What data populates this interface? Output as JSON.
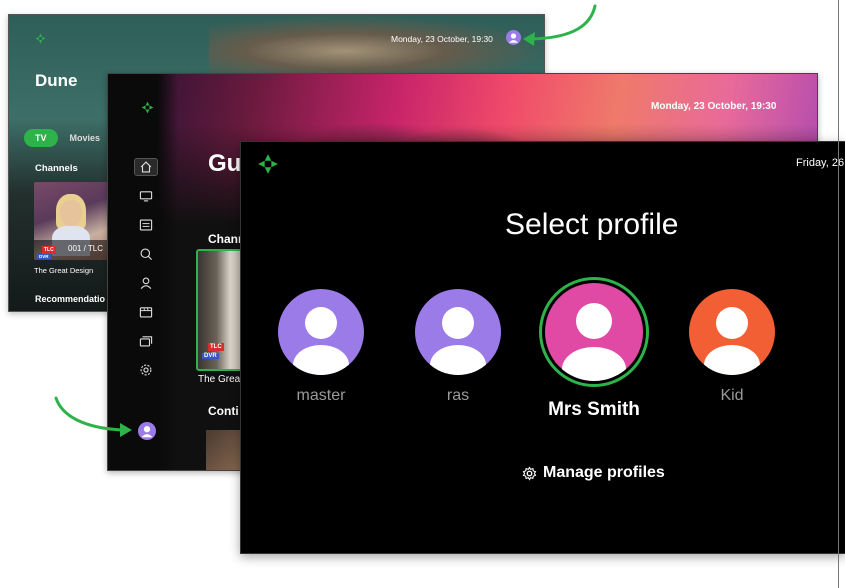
{
  "colors": {
    "accent_green": "#2db34a",
    "avatar_purple": "#9b7be8",
    "avatar_pink": "#e04aa5",
    "avatar_orange": "#f25f35"
  },
  "back_screen": {
    "datetime": "Monday, 23 October, 19:30",
    "hero_title": "Dune",
    "tabs": [
      {
        "label": "TV",
        "active": true
      },
      {
        "label": "Movies",
        "active": false
      }
    ],
    "section_channels": "Channels",
    "channel_card": {
      "badge": "TLC",
      "dvr": "DVR",
      "number_text": "001  /  TLC",
      "title": "The Great Design"
    },
    "section_recommendations": "Recommendatio"
  },
  "middle_screen": {
    "datetime": "Monday, 23 October, 19:30",
    "hero_title": "Gu",
    "section_channels": "Chann",
    "channel_card": {
      "badge": "TLC",
      "dvr": "DVR",
      "title": "The Great"
    },
    "section_continue": "Conti",
    "nav_icons": [
      "home-icon",
      "tv-icon",
      "guide-icon",
      "search-icon",
      "user-icon",
      "movies-icon",
      "recordings-icon",
      "settings-icon"
    ]
  },
  "front_screen": {
    "datetime": "Friday, 26",
    "heading": "Select profile",
    "profiles": [
      {
        "name": "master",
        "color": "#9b7be8",
        "selected": false
      },
      {
        "name": "ras",
        "color": "#9b7be8",
        "selected": false
      },
      {
        "name": "Mrs Smith",
        "color": "#e04aa5",
        "selected": true
      },
      {
        "name": "Kid",
        "color": "#f25f35",
        "selected": false
      }
    ],
    "manage_label": "Manage profiles"
  }
}
